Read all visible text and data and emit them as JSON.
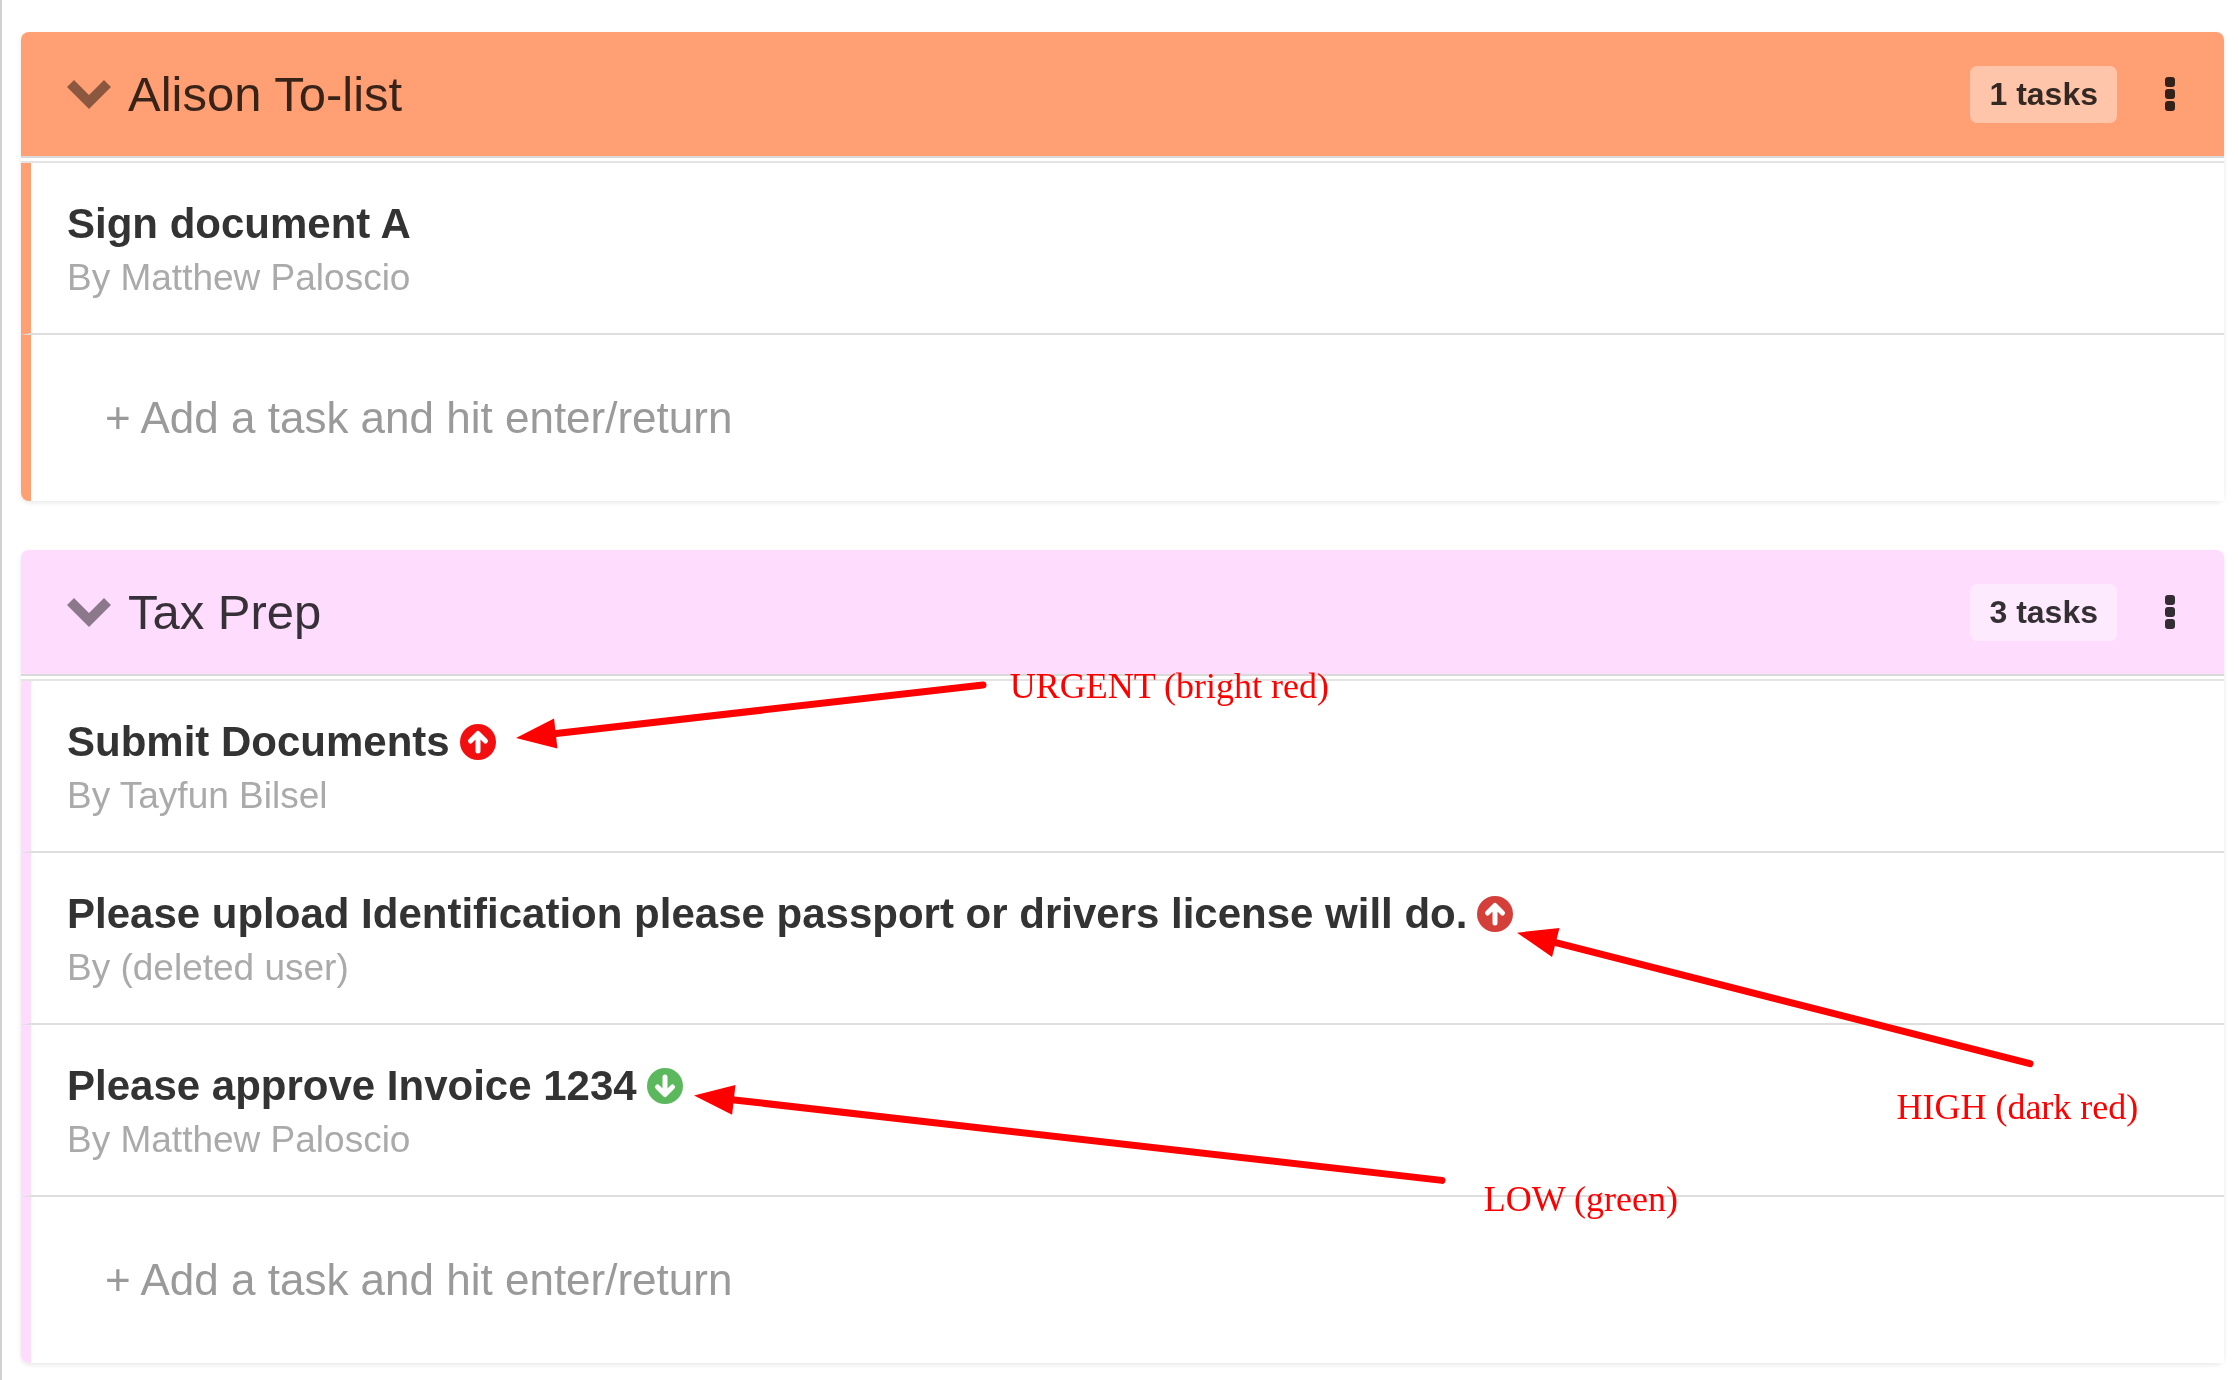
{
  "lists": [
    {
      "title": "Alison To-list",
      "color": "#ff9f73",
      "expanded": true,
      "task_count": "1 tasks",
      "tasks": [
        {
          "kind": "plain",
          "title": "Sign document A",
          "author": "By Matthew Paloscio"
        }
      ],
      "new_task": {
        "placeholder": "+ Add a task and hit enter/return"
      }
    },
    {
      "title": "Tax Prep",
      "color": "#fddcfd",
      "expanded": true,
      "task_count": "3 tasks",
      "tasks": [
        {
          "kind": "urgent",
          "title": "Submit Documents",
          "author": "By Tayfun Bilsel",
          "annotation": "URGENT (bright red)"
        },
        {
          "kind": "high",
          "title": "Please upload Identification please passport or drivers license will do.",
          "author": "By (deleted user)",
          "annotation": "HIGH (dark red)"
        },
        {
          "kind": "low",
          "title": "Please approve Invoice 1234",
          "author": "By Matthew Paloscio",
          "annotation": "LOW (green)"
        }
      ],
      "new_task": {
        "placeholder": "+ Add a task and hit enter/return"
      }
    }
  ]
}
